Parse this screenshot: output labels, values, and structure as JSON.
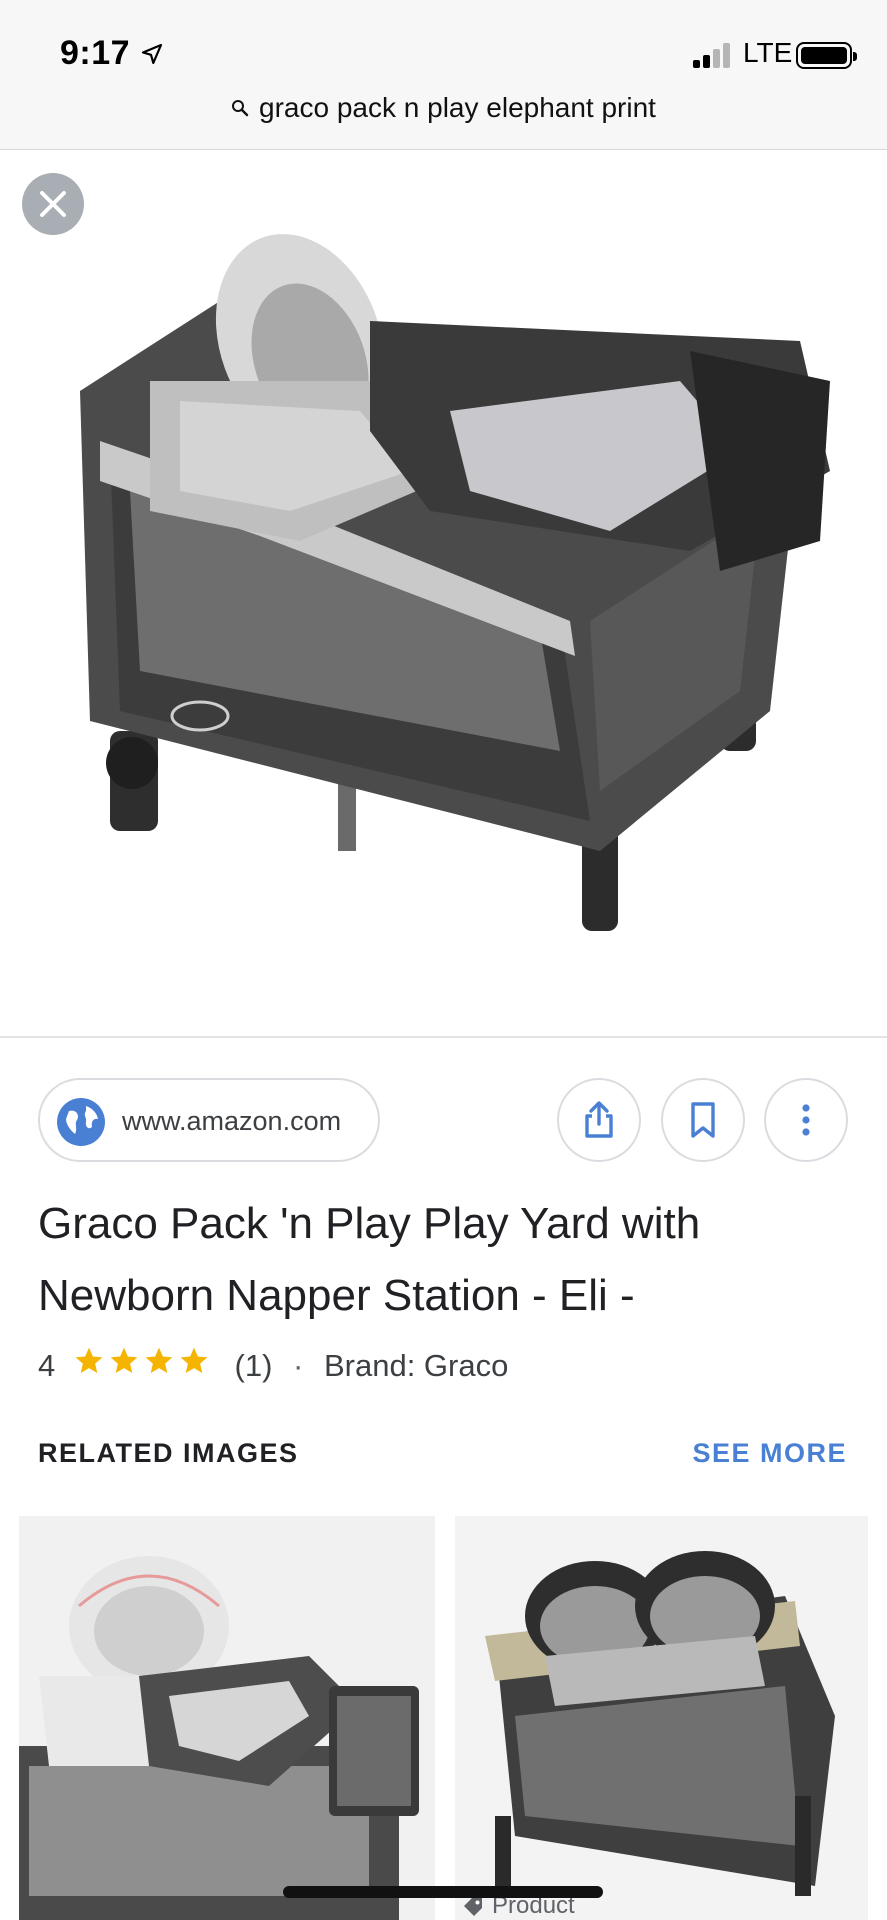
{
  "status_bar": {
    "time": "9:17",
    "network": "LTE"
  },
  "browser": {
    "url_text": "graco pack n play elephant print"
  },
  "result": {
    "source_domain": "www.amazon.com",
    "title": "Graco Pack 'n Play Play Yard with Newborn Napper Station - Eli -",
    "rating": "4",
    "star_count": 4,
    "review_count": "(1)",
    "separator": "·",
    "brand": "Brand: Graco"
  },
  "related": {
    "heading": "RELATED IMAGES",
    "see_more": "SEE MORE"
  },
  "product_chip": "Product",
  "colors": {
    "accent": "#4a80d4",
    "star": "#f5b400",
    "globe": "#4a80d4"
  },
  "icons": [
    "location-arrow-icon",
    "search-icon",
    "close-icon",
    "globe-icon",
    "share-icon",
    "bookmark-icon",
    "more-vert-icon",
    "star-icon",
    "tag-icon"
  ]
}
